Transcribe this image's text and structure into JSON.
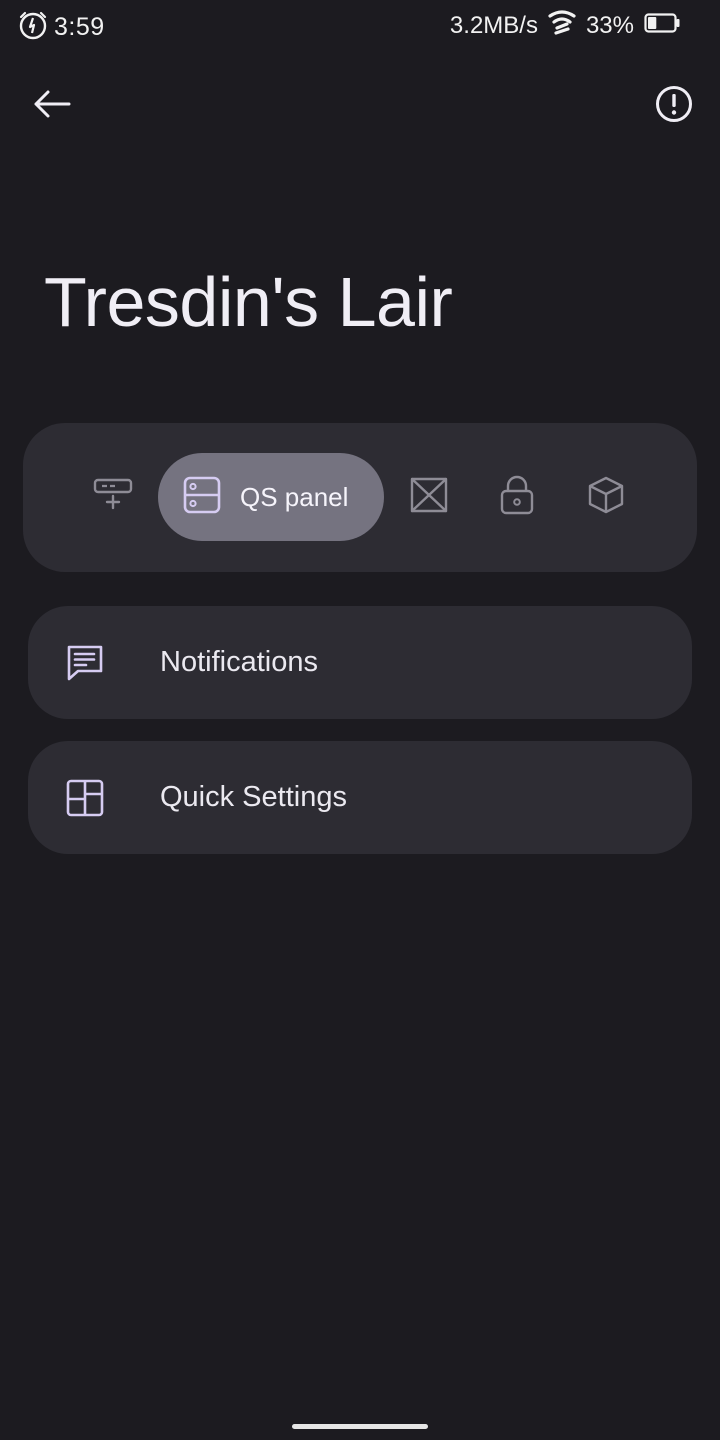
{
  "status_bar": {
    "time": "3:59",
    "network_speed": "3.2MB/s",
    "battery": "33%",
    "battery_level": 0.33,
    "icons": [
      "alarm-icon",
      "wifi-icon",
      "battery-icon"
    ]
  },
  "app_bar": {
    "back_icon": "arrow-left-icon",
    "info_icon": "info-circle-icon"
  },
  "page": {
    "title": "Tresdin's Lair"
  },
  "tabs": {
    "items": [
      {
        "icon": "add-to-panel-icon",
        "label": "",
        "active": false
      },
      {
        "icon": "qs-panel-icon",
        "label": "QS panel",
        "active": true
      },
      {
        "icon": "media-bowtie-icon",
        "label": "",
        "active": false
      },
      {
        "icon": "lock-icon",
        "label": "",
        "active": false
      },
      {
        "icon": "cube-icon",
        "label": "",
        "active": false
      }
    ]
  },
  "list": {
    "items": [
      {
        "icon": "notification-message-icon",
        "label": "Notifications"
      },
      {
        "icon": "grid-layout-icon",
        "label": "Quick Settings"
      }
    ]
  },
  "colors": {
    "background": "#1c1b20",
    "surface": "#2d2c33",
    "active_tab": "#757380",
    "accent_icon": "#d6ccf2",
    "text": "#ebe9f0"
  }
}
